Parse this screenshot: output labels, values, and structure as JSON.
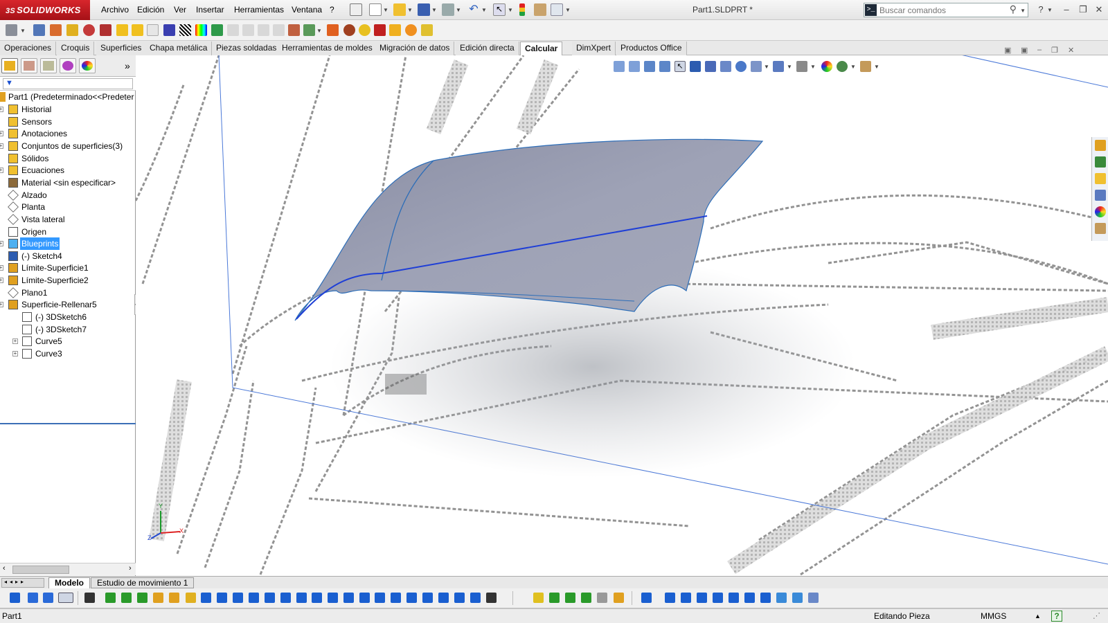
{
  "app": {
    "brand": "SOLIDWORKS",
    "brand_prefix": "3S"
  },
  "menu": [
    "Archivo",
    "Edición",
    "Ver",
    "Insertar",
    "Herramientas",
    "Ventana",
    "?"
  ],
  "document_title": "Part1.SLDPRT *",
  "search": {
    "placeholder": "Buscar comandos"
  },
  "command_tabs": [
    {
      "label": "Operaciones",
      "active": false
    },
    {
      "label": "Croquis",
      "active": false
    },
    {
      "label": "Superficies",
      "active": false
    },
    {
      "label": "Chapa metálica",
      "active": false
    },
    {
      "label": "Piezas soldadas",
      "active": false
    },
    {
      "label": "Herramientas de moldes",
      "active": false
    },
    {
      "label": "Migración de datos",
      "active": false
    },
    {
      "label": "Edición directa",
      "active": false
    },
    {
      "label": "Calcular",
      "active": true
    },
    {
      "label": "DimXpert",
      "active": false
    },
    {
      "label": "Productos Office",
      "active": false
    }
  ],
  "tree": {
    "root": "Part1  (Predeterminado<<Predeter",
    "items": [
      {
        "label": "Historial",
        "icon": "history-icon",
        "expander": true,
        "selected": false
      },
      {
        "label": "Sensors",
        "icon": "sensor-icon",
        "expander": false,
        "selected": false
      },
      {
        "label": "Anotaciones",
        "icon": "annotation-icon",
        "expander": true,
        "selected": false
      },
      {
        "label": "Conjuntos de superficies(3)",
        "icon": "surface-bodies-icon",
        "expander": true,
        "selected": false
      },
      {
        "label": "Sólidos",
        "icon": "solid-bodies-icon",
        "expander": false,
        "selected": false
      },
      {
        "label": "Ecuaciones",
        "icon": "equations-icon",
        "expander": true,
        "selected": false
      },
      {
        "label": "Material <sin especificar>",
        "icon": "material-icon",
        "expander": false,
        "selected": false
      },
      {
        "label": "Alzado",
        "icon": "plane-icon",
        "expander": false,
        "selected": false
      },
      {
        "label": "Planta",
        "icon": "plane-icon",
        "expander": false,
        "selected": false
      },
      {
        "label": "Vista lateral",
        "icon": "plane-icon",
        "expander": false,
        "selected": false
      },
      {
        "label": "Origen",
        "icon": "origin-icon",
        "expander": false,
        "selected": false
      },
      {
        "label": "Blueprints",
        "icon": "folder-icon",
        "expander": true,
        "selected": true
      },
      {
        "label": "(-) Sketch4",
        "icon": "sketch-icon",
        "expander": false,
        "selected": false
      },
      {
        "label": "Límite-Superficie1",
        "icon": "boundary-surface-icon",
        "expander": true,
        "selected": false
      },
      {
        "label": "Límite-Superficie2",
        "icon": "boundary-surface-icon",
        "expander": true,
        "selected": false
      },
      {
        "label": "Plano1",
        "icon": "plane-icon",
        "expander": false,
        "selected": false
      },
      {
        "label": "Superficie-Rellenar5",
        "icon": "fill-surface-icon",
        "expander": true,
        "selected": false
      },
      {
        "label": "(-) 3DSketch6",
        "icon": "3dsketch-icon",
        "expander": false,
        "selected": false,
        "child": true
      },
      {
        "label": "(-) 3DSketch7",
        "icon": "3dsketch-icon",
        "expander": false,
        "selected": false,
        "child": true
      },
      {
        "label": "Curve5",
        "icon": "curve-icon",
        "expander": true,
        "selected": false,
        "child": true
      },
      {
        "label": "Curve3",
        "icon": "curve-icon",
        "expander": true,
        "selected": false,
        "child": true
      }
    ]
  },
  "bottom_tabs": [
    {
      "label": "Modelo",
      "active": true
    },
    {
      "label": "Estudio de movimiento 1",
      "active": false
    }
  ],
  "status": {
    "left": "Part1",
    "mode": "Editando Pieza",
    "units": "MMGS",
    "help": "?"
  },
  "colors": {
    "brand_red": "#c8102e",
    "selection_blue": "#3399ff",
    "surface_fill": "#9a9eb2",
    "edge_blue": "#1f3fd6"
  }
}
